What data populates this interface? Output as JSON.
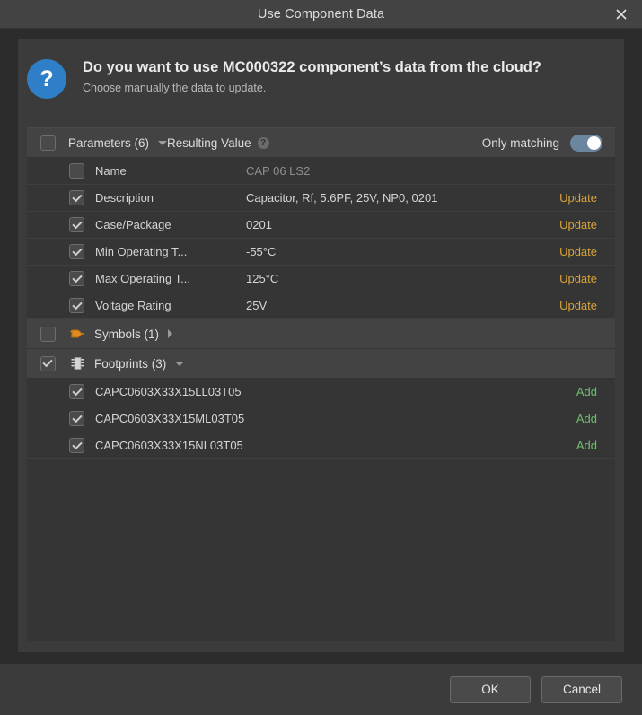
{
  "window": {
    "title": "Use Component Data",
    "close_icon": "close-icon"
  },
  "prompt": {
    "icon": "question-mark-icon",
    "question": "Do you want to use MC000322 component’s data from the cloud?",
    "subtitle": "Choose manually the data to update."
  },
  "table": {
    "header": {
      "parameters_label": "Parameters (6)",
      "resulting_value_label": "Resulting Value",
      "help_glyph": "?",
      "only_matching_label": "Only matching",
      "only_matching_on": true
    },
    "parameters": [
      {
        "name": "Name",
        "value": "CAP 06 LS2",
        "checked": false,
        "action": "",
        "muted": true
      },
      {
        "name": "Description",
        "value": "Capacitor, Rf, 5.6PF, 25V, NP0, 0201",
        "checked": true,
        "action": "Update",
        "muted": false
      },
      {
        "name": "Case/Package",
        "value": "0201",
        "checked": true,
        "action": "Update",
        "muted": false
      },
      {
        "name": "Min Operating T...",
        "value": "-55°C",
        "checked": true,
        "action": "Update",
        "muted": false
      },
      {
        "name": "Max Operating T...",
        "value": "125°C",
        "checked": true,
        "action": "Update",
        "muted": false
      },
      {
        "name": "Voltage Rating",
        "value": "25V",
        "checked": true,
        "action": "Update",
        "muted": false
      }
    ],
    "symbols_group": {
      "label": "Symbols (1)",
      "icon": "symbol-icon",
      "checked": false,
      "expanded": false
    },
    "footprints_group": {
      "label": "Footprints (3)",
      "icon": "footprint-icon",
      "checked": true,
      "expanded": true
    },
    "footprints": [
      {
        "name": "CAPC0603X33X15LL03T05",
        "checked": true,
        "action": "Add"
      },
      {
        "name": "CAPC0603X33X15ML03T05",
        "checked": true,
        "action": "Add"
      },
      {
        "name": "CAPC0603X33X15NL03T05",
        "checked": true,
        "action": "Add"
      }
    ]
  },
  "footer": {
    "ok_label": "OK",
    "cancel_label": "Cancel"
  },
  "colors": {
    "accent_blue": "#2f7fc8",
    "update_amber": "#d8a33a",
    "add_green": "#6cbf6c",
    "toggle_on": "#6d86a0",
    "symbol_orange": "#e08a20"
  }
}
